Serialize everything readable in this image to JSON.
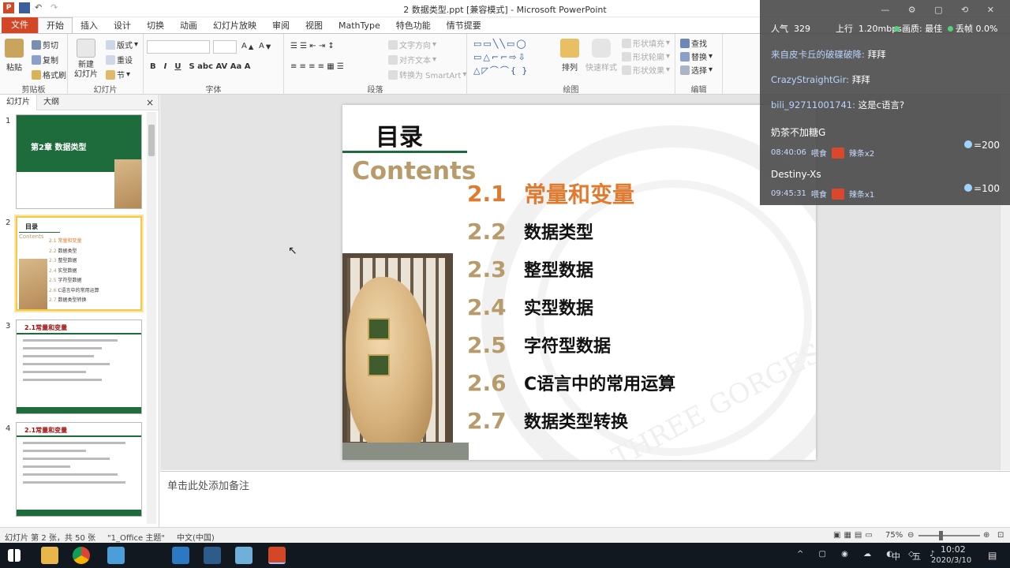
{
  "window": {
    "title": "2 数据类型.ppt [兼容模式] - Microsoft PowerPoint"
  },
  "ribbon_tabs": [
    "文件",
    "开始",
    "插入",
    "设计",
    "切换",
    "动画",
    "幻灯片放映",
    "审阅",
    "视图",
    "MathType",
    "特色功能",
    "情节提要"
  ],
  "ribbon": {
    "clipboard": {
      "paste": "粘贴",
      "cut": "剪切",
      "copy": "复制",
      "format_painter": "格式刷",
      "label": "剪贴板"
    },
    "slides": {
      "new_slide": "新建\n幻灯片",
      "layout": "版式",
      "reset": "重设",
      "section": "节",
      "label": "幻灯片"
    },
    "font": {
      "label": "字体"
    },
    "paragraph": {
      "text_direction": "文字方向",
      "align_text": "对齐文本",
      "smartart": "转换为 SmartArt",
      "label": "段落"
    },
    "drawing": {
      "arrange": "排列",
      "quick_styles": "快速样式",
      "shape_fill": "形状填充",
      "shape_outline": "形状轮廓",
      "shape_effects": "形状效果",
      "label": "绘图"
    },
    "editing": {
      "find": "查找",
      "replace": "替换",
      "select": "选择",
      "label": "编辑"
    }
  },
  "panel": {
    "tabs": [
      "幻灯片",
      "大纲"
    ],
    "close": "×",
    "thumbnails": [
      {
        "num": "1",
        "title": "第2章  数据类型"
      },
      {
        "num": "2",
        "title": "目录"
      },
      {
        "num": "3",
        "title": "2.1常量和变量"
      },
      {
        "num": "4",
        "title": "2.1常量和变量"
      }
    ]
  },
  "slide": {
    "title": "目录",
    "subtitle": "Contents",
    "items": [
      {
        "num": "2.1",
        "text": "常量和变量",
        "highlight": true
      },
      {
        "num": "2.2",
        "text": "数据类型",
        "highlight": false
      },
      {
        "num": "2.3",
        "text": "整型数据",
        "highlight": false
      },
      {
        "num": "2.4",
        "text": "实型数据",
        "highlight": false
      },
      {
        "num": "2.5",
        "text": "字符型数据",
        "highlight": false
      },
      {
        "num": "2.6",
        "text": "C语言中的常用运算",
        "highlight": false
      },
      {
        "num": "2.7",
        "text": "数据类型转换",
        "highlight": false
      }
    ],
    "watermark": "THREE GORGES UNIVERSITY",
    "colors": {
      "green": "#1e6b3c",
      "gold": "#b89b6a",
      "orange": "#e07a2f"
    }
  },
  "notes": {
    "placeholder": "单击此处添加备注"
  },
  "statusbar": {
    "slide_info": "幻灯片 第 2 张，共 50 张",
    "theme": "\"1_Office 主题\"",
    "language": "中文(中国)",
    "zoom": "75%"
  },
  "taskbar": {
    "time": "10:02",
    "date": "2020/3/10",
    "ime": "中",
    "day": "五"
  },
  "overlay": {
    "popularity_label": "人气",
    "popularity": "329",
    "upload_label": "上行",
    "upload": "1.20mbps",
    "quality_label": "画质: 最佳",
    "dropped_label": "丢帧 0.0%",
    "chat": [
      {
        "user": "来自皮卡丘的破碟破降:",
        "text": "拜拜"
      },
      {
        "user": "CrazyStraightGir:",
        "text": "拜拜"
      },
      {
        "user": "bili_92711001741:",
        "text": "这是c语言?"
      }
    ],
    "gifts": [
      {
        "name": "奶茶不加糖G",
        "time": "08:40:06",
        "action": "喂食",
        "item": "辣条x2",
        "value": "=200"
      },
      {
        "name": "Destiny-Xs",
        "time": "09:45:31",
        "action": "喂食",
        "item": "辣条x1",
        "value": "=100"
      }
    ]
  }
}
